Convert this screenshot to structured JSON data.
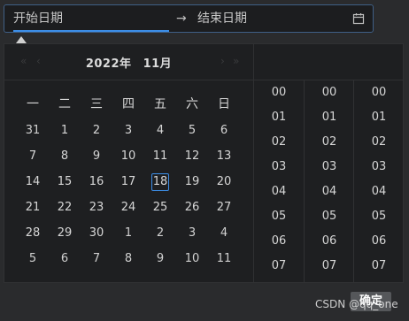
{
  "range": {
    "start_placeholder": "开始日期",
    "separator": "→",
    "end_placeholder": "结束日期"
  },
  "calendar": {
    "year": "2022年",
    "month": "11月",
    "weekdays": [
      "一",
      "二",
      "三",
      "四",
      "五",
      "六",
      "日"
    ],
    "days": [
      {
        "d": "31",
        "other": true
      },
      {
        "d": "1"
      },
      {
        "d": "2"
      },
      {
        "d": "3"
      },
      {
        "d": "4"
      },
      {
        "d": "5"
      },
      {
        "d": "6"
      },
      {
        "d": "7"
      },
      {
        "d": "8"
      },
      {
        "d": "9"
      },
      {
        "d": "10"
      },
      {
        "d": "11"
      },
      {
        "d": "12"
      },
      {
        "d": "13"
      },
      {
        "d": "14"
      },
      {
        "d": "15"
      },
      {
        "d": "16"
      },
      {
        "d": "17"
      },
      {
        "d": "18",
        "today": true
      },
      {
        "d": "19"
      },
      {
        "d": "20"
      },
      {
        "d": "21"
      },
      {
        "d": "22"
      },
      {
        "d": "23"
      },
      {
        "d": "24"
      },
      {
        "d": "25"
      },
      {
        "d": "26"
      },
      {
        "d": "27"
      },
      {
        "d": "28"
      },
      {
        "d": "29"
      },
      {
        "d": "30"
      },
      {
        "d": "1",
        "other": true
      },
      {
        "d": "2",
        "other": true
      },
      {
        "d": "3",
        "other": true
      },
      {
        "d": "4",
        "other": true
      },
      {
        "d": "5",
        "other": true
      },
      {
        "d": "6",
        "other": true
      },
      {
        "d": "7",
        "other": true
      },
      {
        "d": "8",
        "other": true
      },
      {
        "d": "9",
        "other": true
      },
      {
        "d": "10",
        "other": true
      },
      {
        "d": "11",
        "other": true
      }
    ]
  },
  "time": {
    "hours": [
      "00",
      "01",
      "02",
      "03",
      "04",
      "05",
      "06",
      "07"
    ],
    "minutes": [
      "00",
      "01",
      "02",
      "03",
      "04",
      "05",
      "06",
      "07"
    ],
    "seconds": [
      "00",
      "01",
      "02",
      "03",
      "04",
      "05",
      "06",
      "07"
    ]
  },
  "footer": {
    "confirm_label": "确定",
    "watermark": "CSDN @qq_one"
  }
}
